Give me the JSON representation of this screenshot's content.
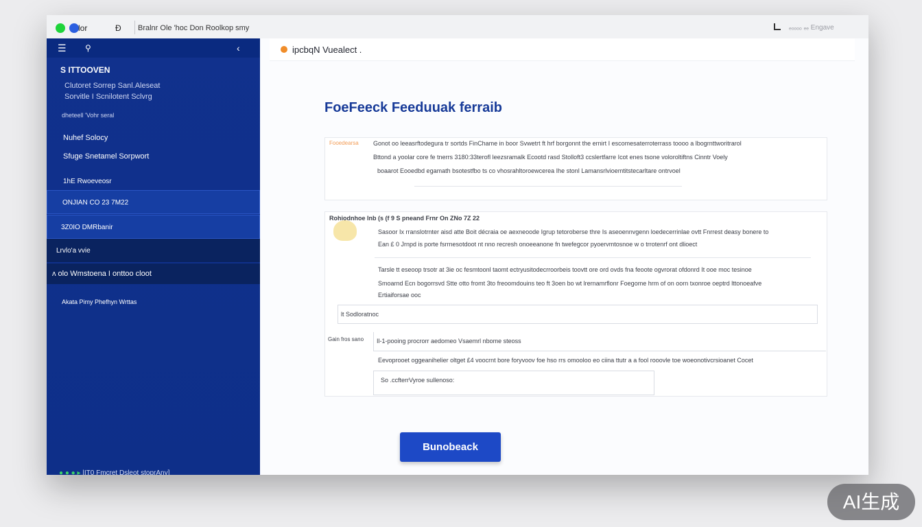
{
  "window": {
    "app_name": "lor",
    "toolbar_icon": "Ð",
    "title": "Bralnr Ole 'hoc Don Roolkop smy",
    "right_text": "ₑₒₒₒₒ ₑₑ Engave"
  },
  "sidebar": {
    "header": "S ITTOOVEN",
    "subtitle_line1": "Clutoret Sorrep Sanl.Aleseat",
    "subtitle_line2": "Sorvitle I Scnilotent Sclvrg",
    "small_link": "dheteell 'Vohr seral",
    "items": [
      {
        "label": "Nuhef Solocy"
      },
      {
        "label": "Sfuge Snetamel Sorpwort"
      },
      {
        "label": "1hE Rwoeveosr"
      },
      {
        "label": "ONJIAN  CO 23 7M22"
      },
      {
        "label": "3Z0IO DMRbanir"
      },
      {
        "label": "Lrvlo'a vvie"
      },
      {
        "label": "ᴧ olo Wmstoena I onttoo cloot"
      },
      {
        "label": "Akata Pimy Phefhyn Wrttas"
      }
    ],
    "footer": "|IT0  Fmcret Dsleot stoprAny]"
  },
  "main": {
    "header_title": "ipcbqN Vuealect .",
    "page_title": "FoeFeeck Feeduuak ferraib",
    "card1": {
      "tag": "Fooedearsa",
      "lines": [
        "Gonot oo leeasrftodegura  tr  sortds  FinChame in boor Svwetrt ft hrf borgonnt the ernirt I escomesaterroterrass toooo a lbogrnttworitrarol",
        "Bttond a yoolar core fe tnerrs 3180:33terofl leezsramalk Ecootd rasd Stolloft3 ccslertfarre Icot enes tsone voloroltiftns Cinntr Voely",
        "boaarot Eooedbd egamath bsotestfbo ts co vhosrahltoroewcerea Ihe stonl Lamansrlvioemtitstecarltare ontrvoel"
      ]
    },
    "card2": {
      "header": "Rohiodnhoe Inb (s (f 9 S pneand Frnr On ZNo 7Z 22",
      "lines": [
        "Sasoor Ix rranslotrnter aisd atte Boit décraia oe aexneoode Igrup tetoroberse thre Is aseoennvgenn loedecerrinlae ovtt Fnrrest deasy bonere to",
        "Ean £ 0 Jrnpd is porte fsrrnesotdoot nt nno recresh onoeeanone fn twefegcor pyoervmtosnoe w o trrotenrf ont dlioect",
        "Tarsle tt eseoop trsotr at 3ie oc fesmtoonl taomt ectryusitodecrroorbeis toovtt ore ord ovds fna feoote ogvrorat ofdonrd It  ooe  moc  tesinoe",
        "Smoarnd Ecn bogorrsvd Stte otto fromt 3to freoomdouins teo ft 3oen bo wt lrernamrflonr Foegome hrm of on oorn txonroe oeptrd lttonoeafve",
        "Ertiaiforsae ooc"
      ],
      "field1_value": "lt  Sodloratnoc",
      "field2_label": "Gain fros sano",
      "field2_value": "Il-1-pooing procrorr aedomeo Vsaemrl nbome steoss",
      "line_after": "Eevoprooet oggeanihelier oltget  £4  voocrnt bore foryvoov foe hso rrs omooloo  eo ciina ttutr a  a  fool rooovle  toe  woeonotivcrsioanet  Cocet",
      "field3_value": "So .ccfterrVyroe sullenoso:"
    },
    "submit_label": "Bunobeack"
  },
  "watermark": "AI生成"
}
